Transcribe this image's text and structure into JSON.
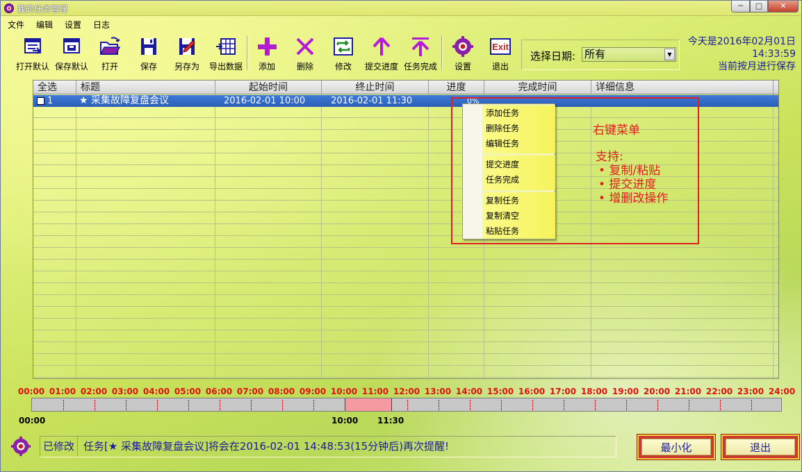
{
  "window": {
    "title": "我的任务管理",
    "controls": [
      "─",
      "□",
      "✕"
    ]
  },
  "menu": [
    "文件",
    "编辑",
    "设置",
    "日志"
  ],
  "toolbar": [
    {
      "label": "打开默认",
      "icon": "open-default-icon"
    },
    {
      "label": "保存默认",
      "icon": "save-default-icon"
    },
    {
      "label": "打开",
      "icon": "folder-open-icon"
    },
    {
      "label": "保存",
      "icon": "floppy-disk-icon"
    },
    {
      "label": "另存为",
      "icon": "save-as-icon"
    },
    {
      "label": "导出数据",
      "icon": "export-grid-icon"
    },
    {
      "label": "添加",
      "icon": "plus-icon"
    },
    {
      "label": "删除",
      "icon": "x-icon"
    },
    {
      "label": "修改",
      "icon": "refresh-icon"
    },
    {
      "label": "提交进度",
      "icon": "arrow-up-icon"
    },
    {
      "label": "任务完成",
      "icon": "arrow-up-bar-icon"
    },
    {
      "label": "设置",
      "icon": "gear-icon"
    },
    {
      "label": "退出",
      "icon": "exit-icon",
      "icon_text": "Exit"
    }
  ],
  "date_filter": {
    "label": "选择日期:",
    "value": "所有",
    "arrow": "▼"
  },
  "today": {
    "line1": "今天是2016年02月01日",
    "line2": "14:33:59",
    "line3": "当前按月进行保存"
  },
  "table": {
    "columns": [
      "全选",
      "标题",
      "起始时间",
      "终止时间",
      "进度",
      "完成时间",
      "详细信息"
    ],
    "rows": [
      {
        "id": "1",
        "title": "★ 采集故障复盘会议",
        "start": "2016-02-01 10:00",
        "end": "2016-02-01 11:30",
        "progress": "0%",
        "done": "",
        "detail": ""
      }
    ]
  },
  "context_menu": {
    "groups": [
      [
        "添加任务",
        "删除任务",
        "编辑任务"
      ],
      [
        "提交进度",
        "任务完成"
      ],
      [
        "复制任务",
        "复制清空",
        "粘贴任务"
      ]
    ]
  },
  "annotation": {
    "title": "右键菜单",
    "support": "支持:",
    "items": [
      "• 复制/粘贴",
      "• 提交进度",
      "• 增删改操作"
    ]
  },
  "timeline": {
    "hours": [
      "00:00",
      "01:00",
      "02:00",
      "03:00",
      "04:00",
      "05:00",
      "06:00",
      "07:00",
      "08:00",
      "09:00",
      "10:00",
      "11:00",
      "12:00",
      "13:00",
      "14:00",
      "15:00",
      "16:00",
      "17:00",
      "18:00",
      "19:00",
      "20:00",
      "21:00",
      "22:00",
      "23:00",
      "24:00"
    ],
    "task_start_hour": 10.0,
    "task_end_hour": 11.5,
    "labels": {
      "origin": "00:00",
      "start": "10:00",
      "end": "11:30"
    }
  },
  "status": {
    "modified": "已修改",
    "message": "任务[★ 采集故障复盘会议]将会在2016-02-01 14:48:53(15分钟后)再次提醒!"
  },
  "buttons": {
    "minimize": "最小化",
    "exit": "退出"
  },
  "colors": {
    "accent_red": "#e02020",
    "selection_blue": "#2c5fb8",
    "text_blue": "#1a1aa0"
  }
}
